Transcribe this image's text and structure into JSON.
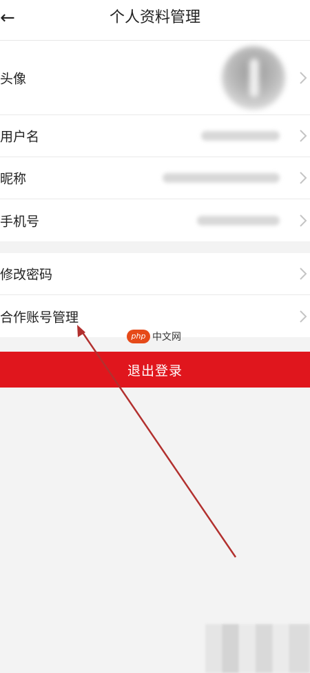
{
  "header": {
    "back_icon": "arrow-left-icon",
    "title": "个人资料管理"
  },
  "profile_rows": [
    {
      "label": "头像",
      "value_type": "avatar"
    },
    {
      "label": "用户名",
      "value_type": "blurred-text"
    },
    {
      "label": "昵称",
      "value_type": "blurred-text"
    },
    {
      "label": "手机号",
      "value_type": "blurred-text"
    }
  ],
  "account_rows": [
    {
      "label": "修改密码"
    },
    {
      "label": "合作账号管理"
    }
  ],
  "logout": {
    "label": "退出登录"
  },
  "watermark": {
    "badge": "php",
    "text": "中文网"
  },
  "colors": {
    "accent": "#e0161d",
    "annotation_arrow": "#b2302e",
    "background": "#f3f3f3"
  }
}
